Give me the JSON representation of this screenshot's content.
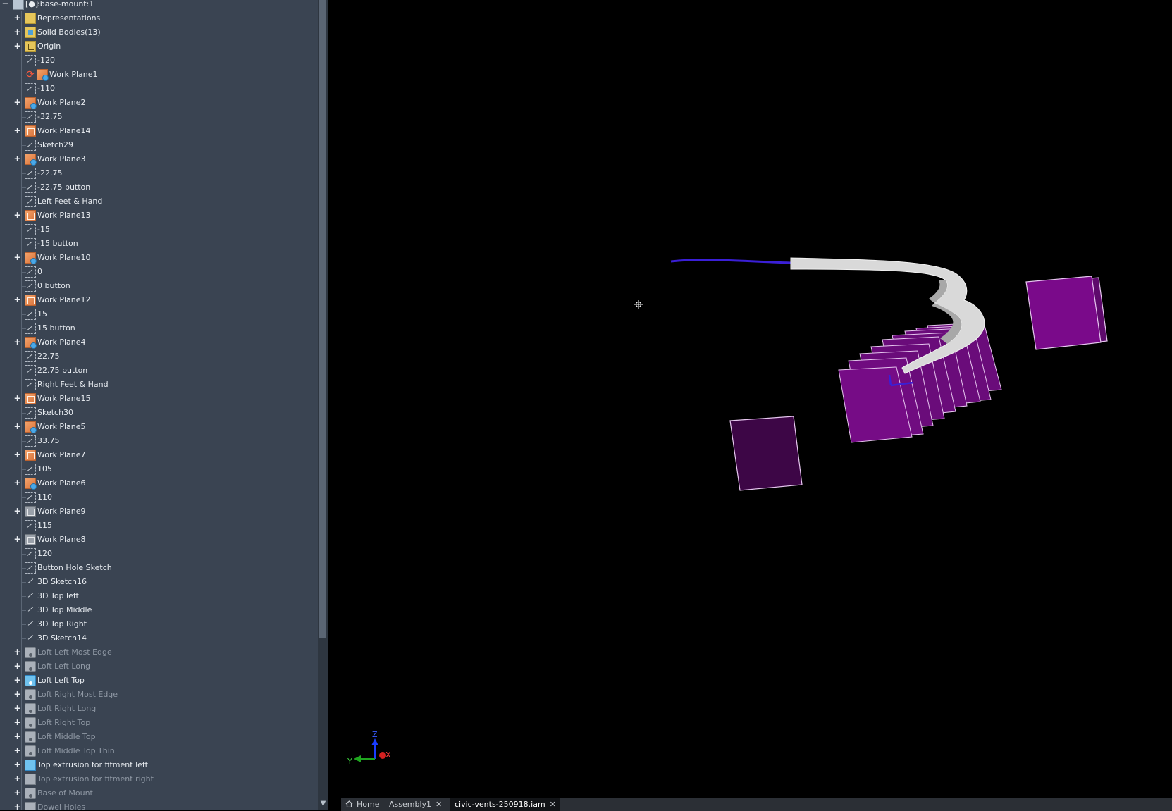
{
  "browser": {
    "items": [
      {
        "label": ":base-mount:1",
        "icon": "assembly-icon",
        "expander": "-",
        "level": 0
      },
      {
        "label": "Representations",
        "icon": "folder-icon",
        "expander": "+",
        "level": 1
      },
      {
        "label": "Solid Bodies(13)",
        "icon": "solid-bodies-icon",
        "expander": "+",
        "level": 1
      },
      {
        "label": "Origin",
        "icon": "origin-icon",
        "expander": "+",
        "level": 1
      },
      {
        "label": "-120",
        "icon": "sketch-icon",
        "level": 1
      },
      {
        "label": "Work Plane1",
        "icon": "work-plane-shared-icon",
        "sync": true,
        "level": 1
      },
      {
        "label": "-110",
        "icon": "sketch-icon",
        "level": 1
      },
      {
        "label": "Work Plane2",
        "icon": "work-plane-shared-icon",
        "expander": "+",
        "level": 1
      },
      {
        "label": "-32.75",
        "icon": "sketch-icon",
        "level": 1
      },
      {
        "label": "Work Plane14",
        "icon": "work-plane-icon",
        "expander": "+",
        "level": 1
      },
      {
        "label": "Sketch29",
        "icon": "sketch-icon",
        "level": 1
      },
      {
        "label": "Work Plane3",
        "icon": "work-plane-shared-icon",
        "expander": "+",
        "level": 1
      },
      {
        "label": "-22.75",
        "icon": "sketch-icon",
        "level": 1
      },
      {
        "label": "-22.75 button",
        "icon": "sketch-icon",
        "level": 1
      },
      {
        "label": "Left Feet & Hand",
        "icon": "sketch-icon",
        "level": 1
      },
      {
        "label": "Work Plane13",
        "icon": "work-plane-icon",
        "expander": "+",
        "level": 1
      },
      {
        "label": "-15",
        "icon": "sketch-icon",
        "level": 1
      },
      {
        "label": "-15 button",
        "icon": "sketch-icon",
        "level": 1
      },
      {
        "label": "Work Plane10",
        "icon": "work-plane-shared-icon",
        "expander": "+",
        "level": 1
      },
      {
        "label": "0",
        "icon": "sketch-icon",
        "level": 1
      },
      {
        "label": "0 button",
        "icon": "sketch-icon",
        "level": 1
      },
      {
        "label": "Work Plane12",
        "icon": "work-plane-icon",
        "expander": "+",
        "level": 1
      },
      {
        "label": "15",
        "icon": "sketch-icon",
        "level": 1
      },
      {
        "label": "15 button",
        "icon": "sketch-icon",
        "level": 1
      },
      {
        "label": "Work Plane4",
        "icon": "work-plane-shared-icon",
        "expander": "+",
        "level": 1
      },
      {
        "label": "22.75",
        "icon": "sketch-icon",
        "level": 1
      },
      {
        "label": "22.75 button",
        "icon": "sketch-icon",
        "level": 1
      },
      {
        "label": "Right Feet & Hand",
        "icon": "sketch-icon",
        "level": 1
      },
      {
        "label": "Work Plane15",
        "icon": "work-plane-icon",
        "expander": "+",
        "level": 1
      },
      {
        "label": "Sketch30",
        "icon": "sketch-icon",
        "level": 1
      },
      {
        "label": "Work Plane5",
        "icon": "work-plane-shared-icon",
        "expander": "+",
        "level": 1
      },
      {
        "label": "33.75",
        "icon": "sketch-icon",
        "level": 1
      },
      {
        "label": "Work Plane7",
        "icon": "work-plane-icon",
        "expander": "+",
        "level": 1
      },
      {
        "label": "105",
        "icon": "sketch-icon",
        "level": 1
      },
      {
        "label": "Work Plane6",
        "icon": "work-plane-shared-icon",
        "expander": "+",
        "level": 1
      },
      {
        "label": "110",
        "icon": "sketch-icon",
        "level": 1
      },
      {
        "label": "Work Plane9",
        "icon": "work-plane-gray-icon",
        "expander": "+",
        "level": 1
      },
      {
        "label": "115",
        "icon": "sketch-icon",
        "level": 1
      },
      {
        "label": "Work Plane8",
        "icon": "work-plane-gray-icon",
        "expander": "+",
        "level": 1
      },
      {
        "label": "120",
        "icon": "sketch-icon",
        "level": 1
      },
      {
        "label": "Button Hole Sketch",
        "icon": "sketch-icon",
        "level": 1
      },
      {
        "label": "3D Sketch16",
        "icon": "3d-sketch-icon",
        "level": 1
      },
      {
        "label": "3D Top left",
        "icon": "3d-sketch-icon",
        "level": 1
      },
      {
        "label": "3D Top Middle",
        "icon": "3d-sketch-icon",
        "level": 1
      },
      {
        "label": "3D Top Right",
        "icon": "3d-sketch-icon",
        "level": 1
      },
      {
        "label": "3D Sketch14",
        "icon": "3d-sketch-icon",
        "level": 1
      },
      {
        "label": "Loft Left Most Edge",
        "icon": "loft-icon",
        "expander": "+",
        "dim": true,
        "level": 1
      },
      {
        "label": "Loft Left Long",
        "icon": "loft-icon",
        "expander": "+",
        "dim": true,
        "level": 1
      },
      {
        "label": "Loft Left Top",
        "icon": "loft-active-icon",
        "expander": "+",
        "level": 1
      },
      {
        "label": "Loft Right Most Edge",
        "icon": "loft-icon",
        "expander": "+",
        "dim": true,
        "level": 1
      },
      {
        "label": "Loft Right Long",
        "icon": "loft-icon",
        "expander": "+",
        "dim": true,
        "level": 1
      },
      {
        "label": "Loft Right Top",
        "icon": "loft-icon",
        "expander": "+",
        "dim": true,
        "level": 1
      },
      {
        "label": "Loft Middle Top",
        "icon": "loft-icon",
        "expander": "+",
        "dim": true,
        "level": 1
      },
      {
        "label": "Loft Middle Top Thin",
        "icon": "loft-icon",
        "expander": "+",
        "dim": true,
        "level": 1
      },
      {
        "label": "Top extrusion for fitment left",
        "icon": "extrusion-active-icon",
        "expander": "+",
        "level": 1
      },
      {
        "label": "Top extrusion for fitment right",
        "icon": "extrusion-icon",
        "expander": "+",
        "dim": true,
        "level": 1
      },
      {
        "label": "Base of Mount",
        "icon": "loft-icon",
        "expander": "+",
        "dim": true,
        "level": 1
      },
      {
        "label": "Dowel Holes",
        "icon": "extrusion-icon",
        "expander": "+",
        "dim": true,
        "level": 1
      }
    ]
  },
  "viewport": {
    "triad": {
      "z_label": "Z",
      "y_label": "Y",
      "x_label": "X"
    },
    "colors": {
      "background": "#000000",
      "solid": "#d9d9d9",
      "plane": "#7a0a8a",
      "plane_edge": "#e7c7f0",
      "path": "#3a1fd6"
    }
  },
  "tabs": [
    {
      "label": "Home",
      "icon": "home-icon",
      "closable": false,
      "active": false
    },
    {
      "label": "Assembly1",
      "closable": true,
      "active": false
    },
    {
      "label": "civic-vents-250918.iam",
      "closable": true,
      "active": true
    }
  ]
}
